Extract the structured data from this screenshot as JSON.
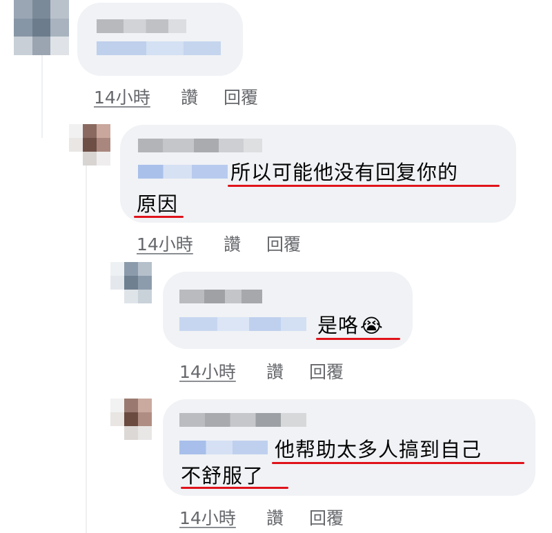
{
  "comments": [
    {
      "id": "c1",
      "author_name": "",
      "message_lines": [],
      "actions": {
        "time": "14小時",
        "like": "讚",
        "reply": "回覆"
      }
    },
    {
      "id": "c2",
      "author_name": "",
      "message_lines": [
        "所以可能他没有回复你的",
        "原因"
      ],
      "actions": {
        "time": "14小時",
        "like": "讚",
        "reply": "回覆"
      }
    },
    {
      "id": "c3",
      "author_name": "",
      "message_lines": [
        "是咯"
      ],
      "emoji": "😭",
      "emoji_name": "loudly-crying-face",
      "actions": {
        "time": "14小時",
        "like": "讚",
        "reply": "回覆"
      }
    },
    {
      "id": "c4",
      "author_name": "",
      "message_lines": [
        "他帮助太多人搞到自己",
        "不舒服了"
      ],
      "actions": {
        "time": "14小時",
        "like": "讚",
        "reply": "回覆"
      }
    }
  ],
  "colors": {
    "bubble": "#f0f2f5",
    "underline": "#e0121a",
    "meta_text": "#65676b"
  }
}
